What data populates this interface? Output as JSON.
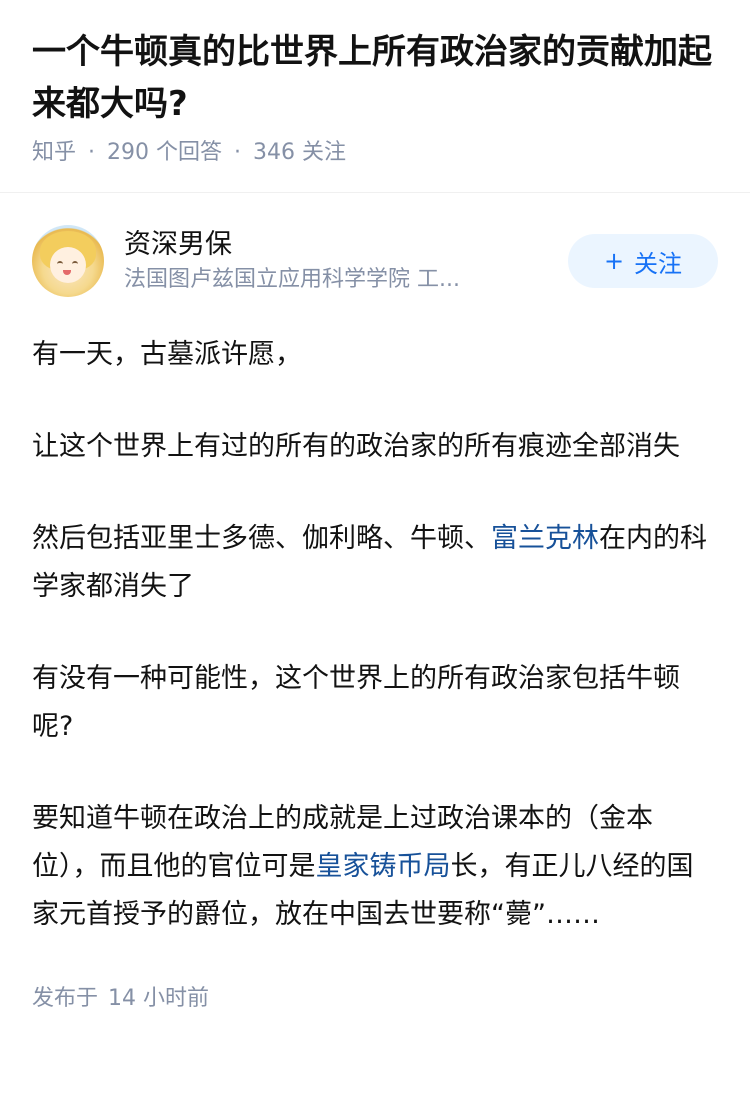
{
  "question": {
    "title": "一个牛顿真的比世界上所有政治家的贡献加起来都大吗?",
    "source": "知乎",
    "separator": "·",
    "answer_count": "290",
    "answer_count_label": "个回答",
    "follower_count": "346",
    "follower_label": "关注"
  },
  "author": {
    "name": "资深男保",
    "headline": "法国图卢兹国立应用科学学院 工...",
    "avatar_icon": "anime-girl-avatar",
    "follow_label": "关注",
    "follow_icon": "+"
  },
  "answer": {
    "paragraphs": [
      {
        "text": "有一天，古墓派许愿，"
      },
      {
        "text": "让这个世界上有过的所有的政治家的所有痕迹全部消失"
      },
      {
        "before": "然后包括亚里士多德、伽利略、牛顿、",
        "link": "富兰克林",
        "after": "在内的科学家都消失了"
      },
      {
        "text": "有没有一种可能性，这个世界上的所有政治家包括牛顿呢?"
      },
      {
        "before": "要知道牛顿在政治上的成就是上过政治课本的（金本位），而且他的官位可是",
        "link": "皇家铸币局",
        "after": "长，有正儿八经的国家元首授予的爵位，放在中国去世要称“薨”……"
      }
    ],
    "published_label": "发布于",
    "published_time": "14 小时前"
  },
  "colors": {
    "link": "#175199",
    "meta": "#8590a6",
    "follow_bg": "#ebf5ff",
    "follow_text": "#1772f6"
  }
}
